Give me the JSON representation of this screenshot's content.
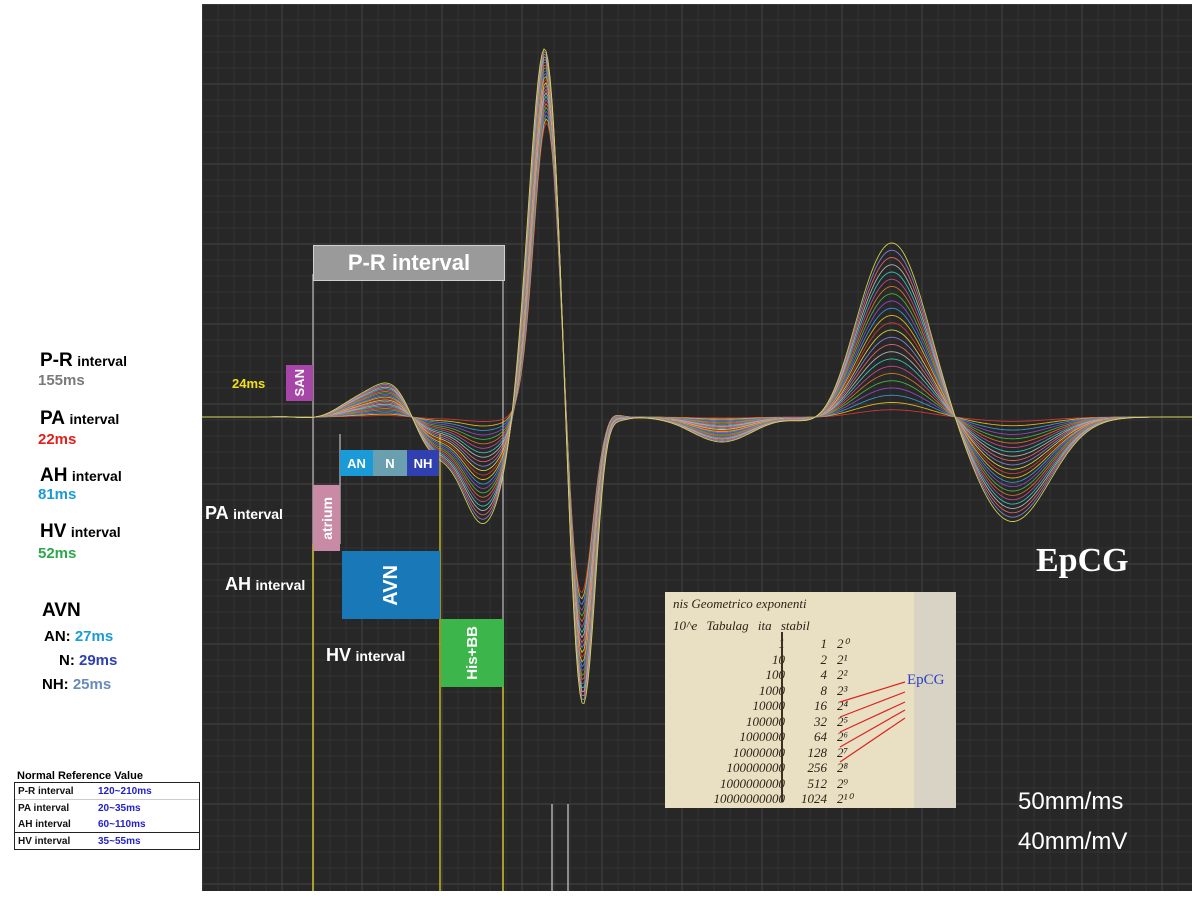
{
  "colors": {
    "plot_bg": "#272727",
    "grid": "#3a3a3a",
    "pr_gray": "#7a7a7a",
    "pa_red": "#e0201c",
    "ah_blue": "#1a9ad6",
    "hv_green": "#2aa84a",
    "an_blue": "#1a9ad6",
    "n_blue": "#3040b0",
    "nh_gray": "#6a8ab8",
    "san_purple": "#a845a8",
    "atrium_pink": "#c98aa5",
    "avn_blue": "#1878b8",
    "his_green": "#3cb54a",
    "yellow": "#f2e01a"
  },
  "left": {
    "pr": {
      "name": "P-R",
      "suffix": "interval",
      "value": "155ms"
    },
    "pa": {
      "name": "PA",
      "suffix": "interval",
      "value": "22ms"
    },
    "ah": {
      "name": "AH",
      "suffix": "interval",
      "value": "81ms"
    },
    "hv": {
      "name": "HV",
      "suffix": "interval",
      "value": "52ms"
    },
    "avn": {
      "title": "AVN",
      "an_label": "AN:",
      "an_value": "27ms",
      "n_label": "N:",
      "n_value": "29ms",
      "nh_label": "NH:",
      "nh_value": "25ms"
    }
  },
  "reference": {
    "title": "Normal Reference Value",
    "rows": [
      {
        "name": "P-R interval",
        "value": "120~210ms"
      },
      {
        "name": "PA interval",
        "value": "20~35ms"
      },
      {
        "name": "AH interval",
        "value": "60~110ms"
      },
      {
        "name": "HV interval",
        "value": "35~55ms"
      }
    ]
  },
  "diagram": {
    "pr_box": "P-R interval",
    "san_time": "24ms",
    "san": "SAN",
    "an": "AN",
    "n": "N",
    "nh": "NH",
    "atrium": "atrium",
    "avn": "AVN",
    "his": "His+BB",
    "pa_label": "PA",
    "ah_label": "AH",
    "hv_label": "HV",
    "interval_word": "interval"
  },
  "title": "EpCG",
  "scale": {
    "time": "50mm/ms",
    "voltage": "40mm/mV"
  },
  "inset": {
    "header": "nis Geometrico  exponenti",
    "col_head": "10^e   Tabulag  ita stabil",
    "powers": [
      "1",
      "10",
      "100",
      "1000",
      "10000",
      "100000",
      "1000000",
      "10000000",
      "100000000",
      "1000000000",
      "10000000000"
    ],
    "doubles": [
      "1",
      "2",
      "4",
      "8",
      "16",
      "32",
      "64",
      "128",
      "256",
      "512",
      "1024"
    ],
    "exps": [
      "2⁰",
      "2¹",
      "2²",
      "2³",
      "2⁴",
      "2⁵",
      "2⁶",
      "2⁷",
      "2⁸",
      "2⁹",
      "2¹⁰"
    ],
    "tag": "EpCG"
  }
}
